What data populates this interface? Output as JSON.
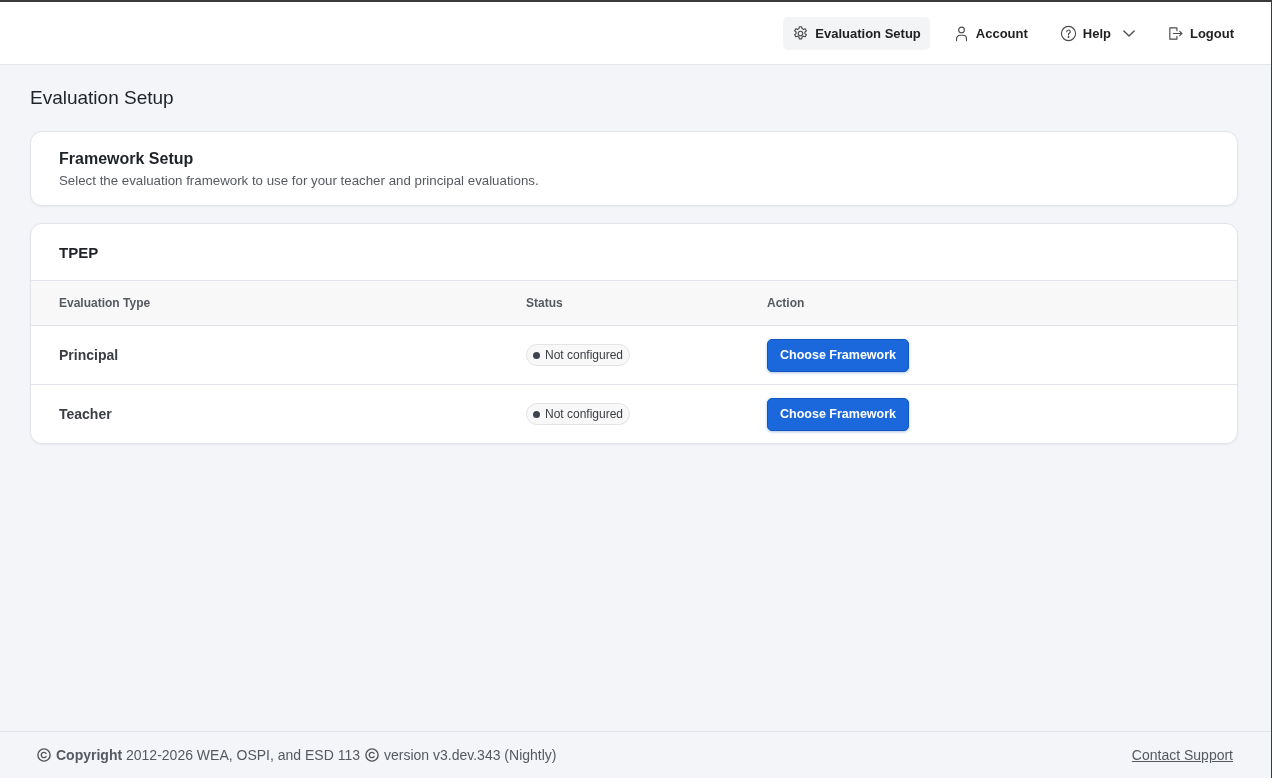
{
  "nav": [
    {
      "label": "Evaluation Setup",
      "kind": "gear",
      "selected": true,
      "dropdown": false
    },
    {
      "label": "Account",
      "kind": "person",
      "selected": false,
      "dropdown": false
    },
    {
      "label": "Help",
      "kind": "question",
      "selected": false,
      "dropdown": true
    },
    {
      "label": "Logout",
      "kind": "logout",
      "selected": false,
      "dropdown": false
    }
  ],
  "page_title": "Evaluation Setup",
  "framework_setup": {
    "title": "Framework Setup",
    "description": "Select the evaluation framework to use for your teacher and principal evaluations."
  },
  "framework_table": {
    "title": "TPEP",
    "columns": [
      "Evaluation Type",
      "Status",
      "Action"
    ],
    "rows": [
      {
        "evaluation_type": "Principal",
        "status": "Not configured",
        "action": "Choose Framework"
      },
      {
        "evaluation_type": "Teacher",
        "status": "Not configured",
        "action": "Choose Framework"
      }
    ]
  },
  "footer": {
    "copyright": "**Copyright** 2012-2026 WEA, OSPI, and ESD 113",
    "version": "version v3.dev.343 (Nightly)",
    "link": "Contact Support"
  }
}
